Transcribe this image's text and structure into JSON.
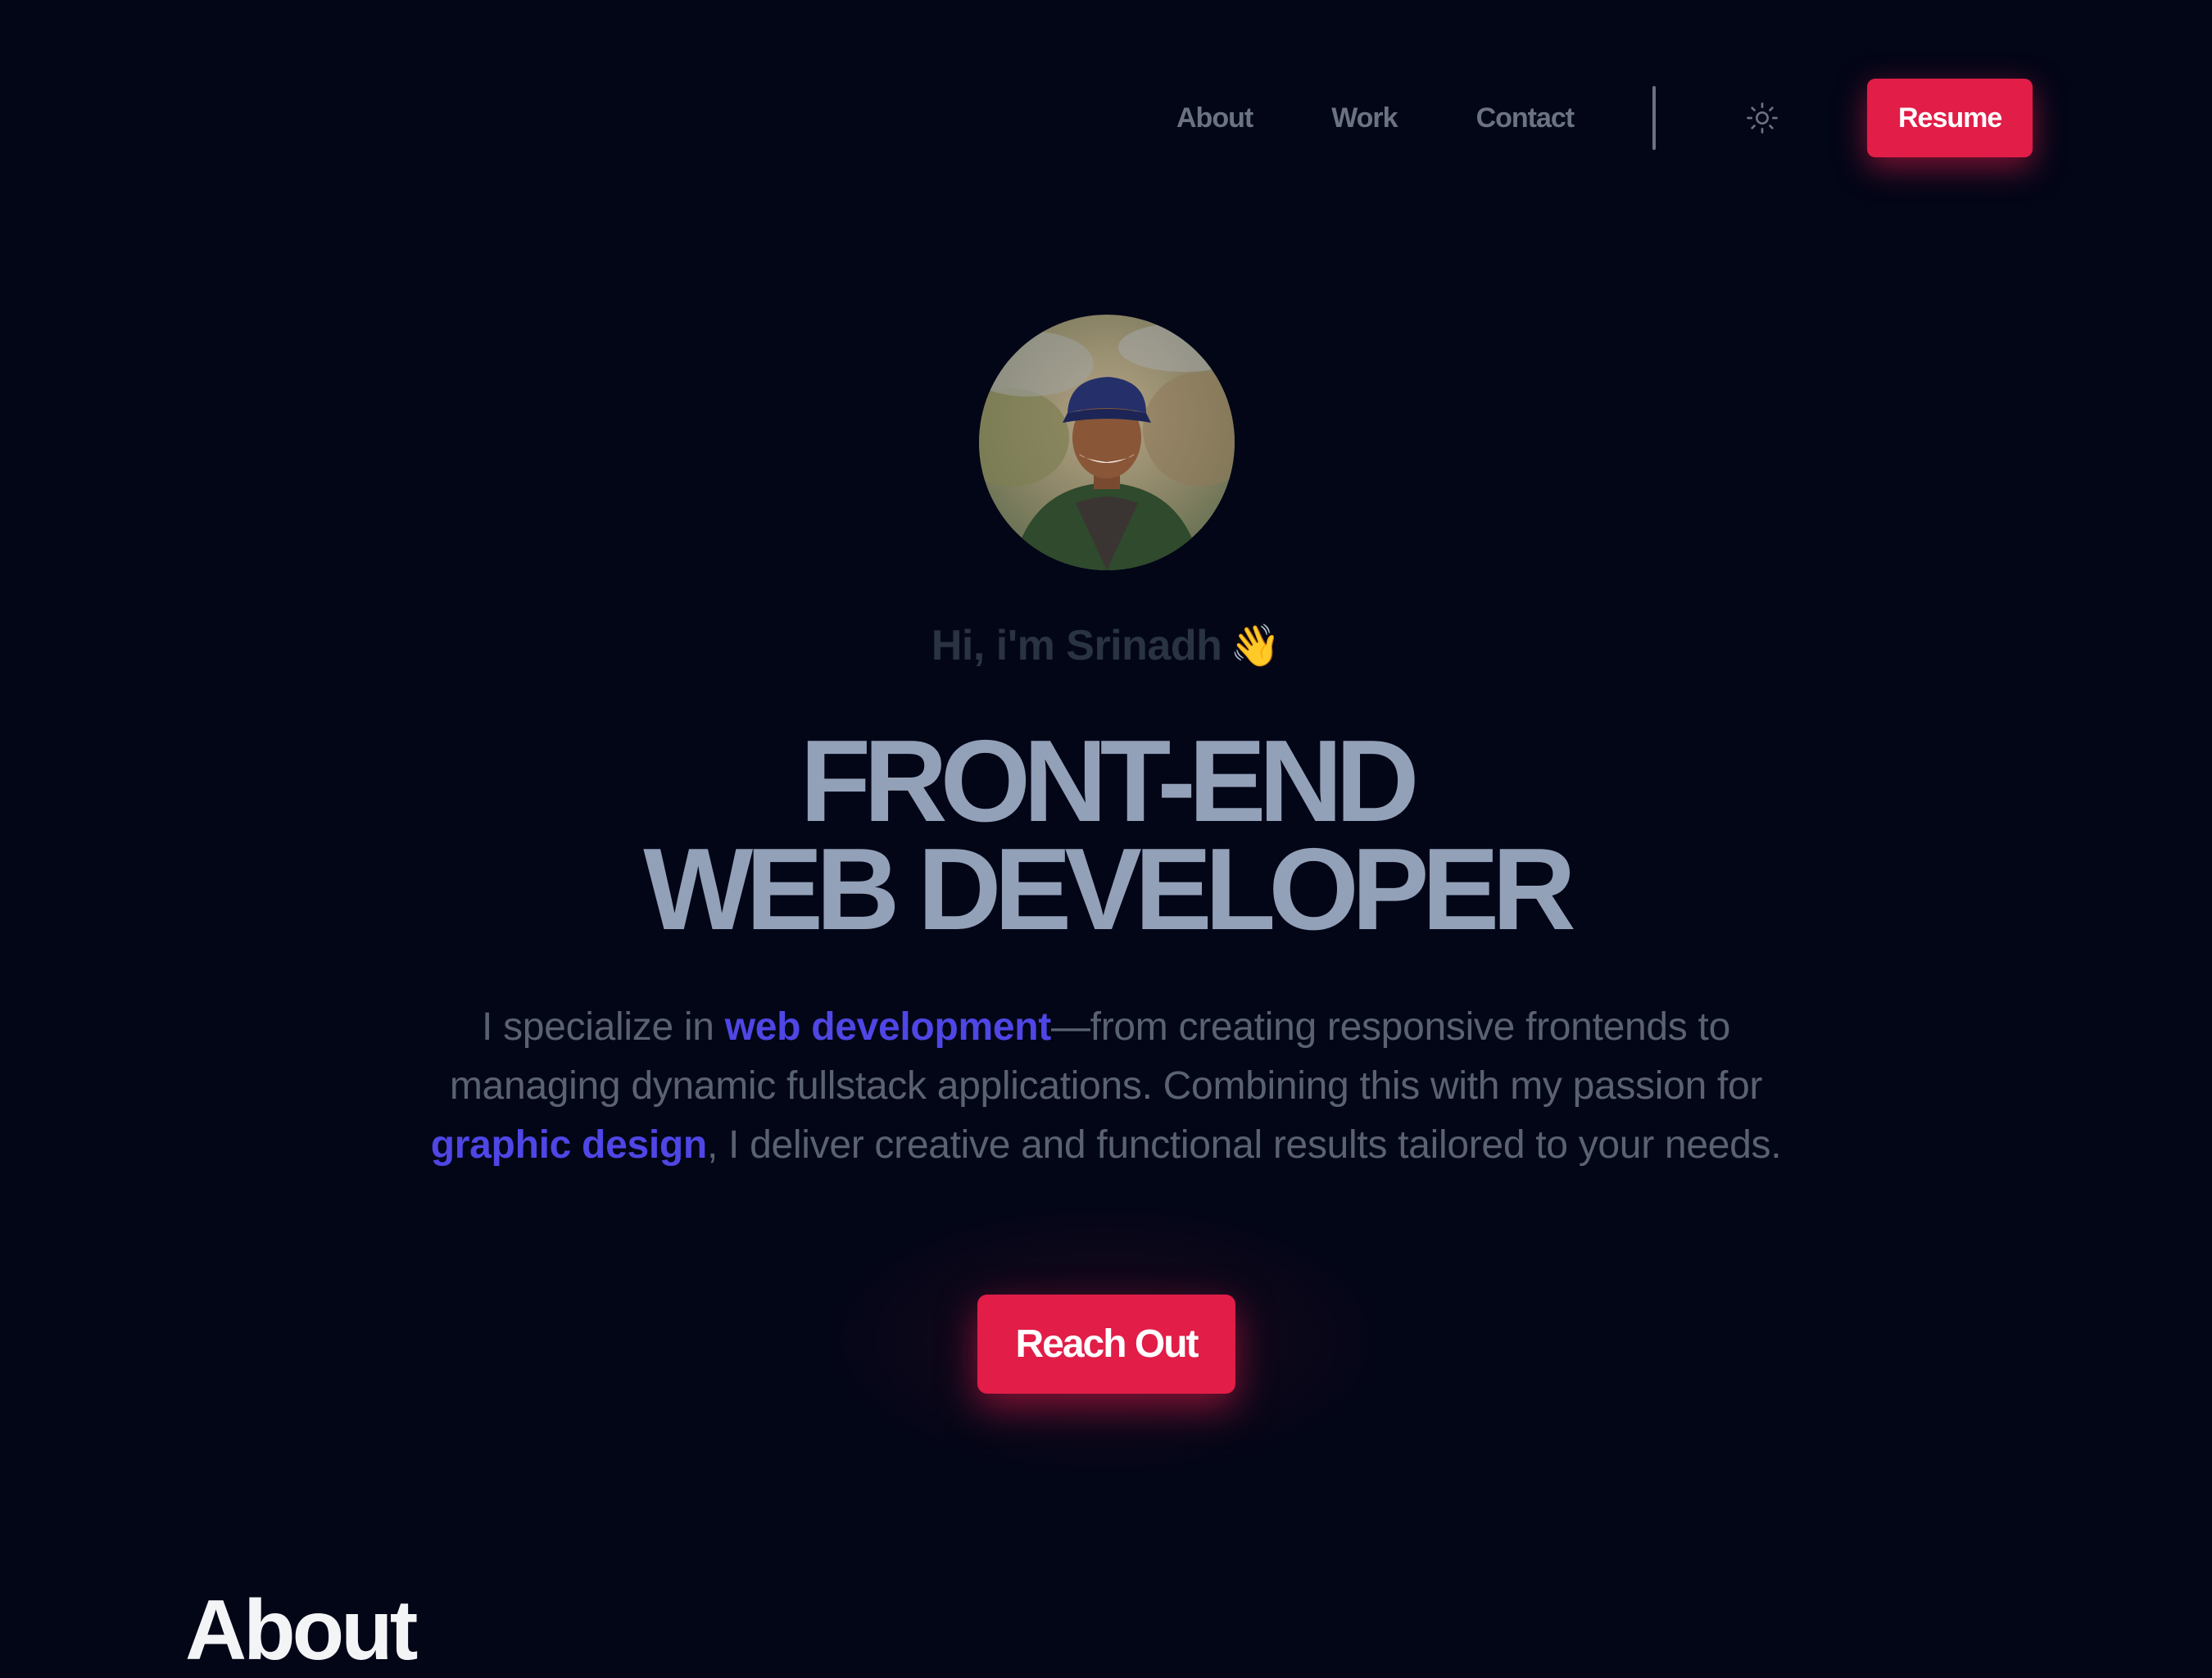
{
  "nav": {
    "links": [
      "About",
      "Work",
      "Contact"
    ],
    "theme_toggle_icon": "sun-icon",
    "resume_label": "Resume"
  },
  "hero": {
    "greeting": "Hi, i'm Srinadh",
    "greeting_emoji": "👋",
    "headline_line1": "FRONT-END",
    "headline_line2": "WEB DEVELOPER",
    "intro": {
      "part1": "I specialize in ",
      "highlight1": "web development",
      "part2": "—from creating responsive frontends to managing dynamic fullstack applications. Combining this with my passion for ",
      "highlight2": "graphic design",
      "part3": ", I deliver creative and functional results tailored to your needs."
    },
    "cta_label": "Reach Out"
  },
  "about": {
    "heading": "About"
  },
  "colors": {
    "background": "#030617",
    "accent": "#e11d48",
    "highlight": "#4f46e5",
    "headline": "#93a1b8",
    "nav_text": "#6b7282"
  }
}
